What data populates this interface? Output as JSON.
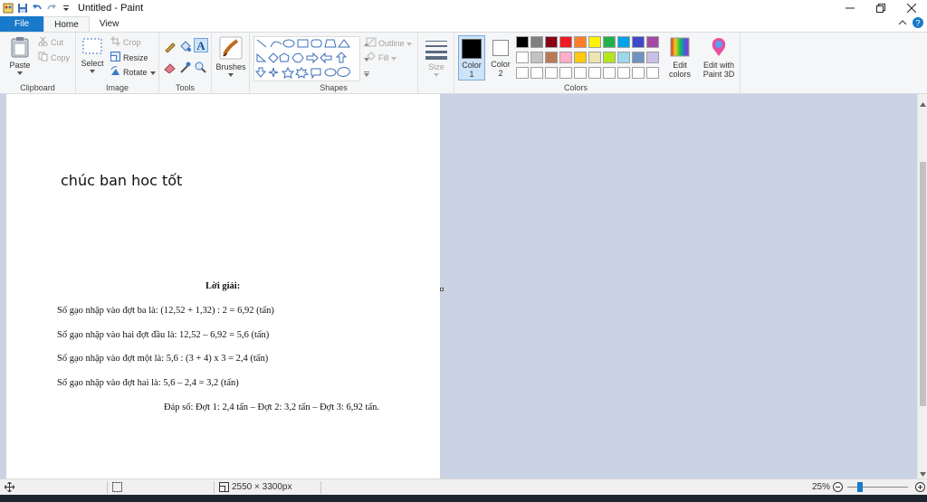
{
  "app": {
    "title": "Untitled - Paint"
  },
  "tabs": {
    "file": "File",
    "home": "Home",
    "view": "View"
  },
  "clipboard": {
    "paste": "Paste",
    "cut": "Cut",
    "copy": "Copy",
    "group": "Clipboard"
  },
  "image": {
    "select": "Select",
    "crop": "Crop",
    "resize": "Resize",
    "rotate": "Rotate",
    "group": "Image"
  },
  "tools": {
    "group": "Tools"
  },
  "brushes": {
    "label": "Brushes"
  },
  "shapes": {
    "outline": "Outline",
    "fill": "Fill",
    "group": "Shapes"
  },
  "size": {
    "label": "Size"
  },
  "colors": {
    "color1_label": "Color",
    "color1_num": "1",
    "color2_label": "Color",
    "color2_num": "2",
    "edit_label": "Edit",
    "edit_label2": "colors",
    "edit3d_label": "Edit with",
    "edit3d_label2": "Paint 3D",
    "group": "Colors",
    "color1": "#000000",
    "color2": "#ffffff",
    "palette_row1": [
      "#000000",
      "#7f7f7f",
      "#880015",
      "#ed1c24",
      "#ff7f27",
      "#fff200",
      "#22b14c",
      "#00a2e8",
      "#3f48cc",
      "#a349a4"
    ],
    "palette_row2": [
      "#ffffff",
      "#c3c3c3",
      "#b97a57",
      "#ffaec9",
      "#ffc90e",
      "#efe4b0",
      "#b5e61d",
      "#99d9ea",
      "#7092be",
      "#c8bfe7"
    ]
  },
  "canvas": {
    "note": "chúc ban hoc tốt",
    "heading": "Lời giải:",
    "lines": [
      "Số gạo nhập vào đợt ba là: (12,52 + 1,32) : 2 = 6,92 (tấn)",
      "Số gạo nhập vào hai đợt đầu là: 12,52 – 6,92 = 5,6 (tấn)",
      "Số gạo nhập vào đợt một là: 5,6 : (3 + 4) x 3 = 2,4 (tấn)",
      "Số gạo nhập vào đợt hai là: 5,6 – 2,4 = 3,2 (tấn)"
    ],
    "answer": "Đáp số: Đợt 1: 2,4 tấn – Đợt 2: 3,2 tấn – Đợt 3: 6,92 tấn."
  },
  "status": {
    "dimensions": "2550 × 3300px",
    "zoom": "25%",
    "zoom_level": 0.25
  }
}
